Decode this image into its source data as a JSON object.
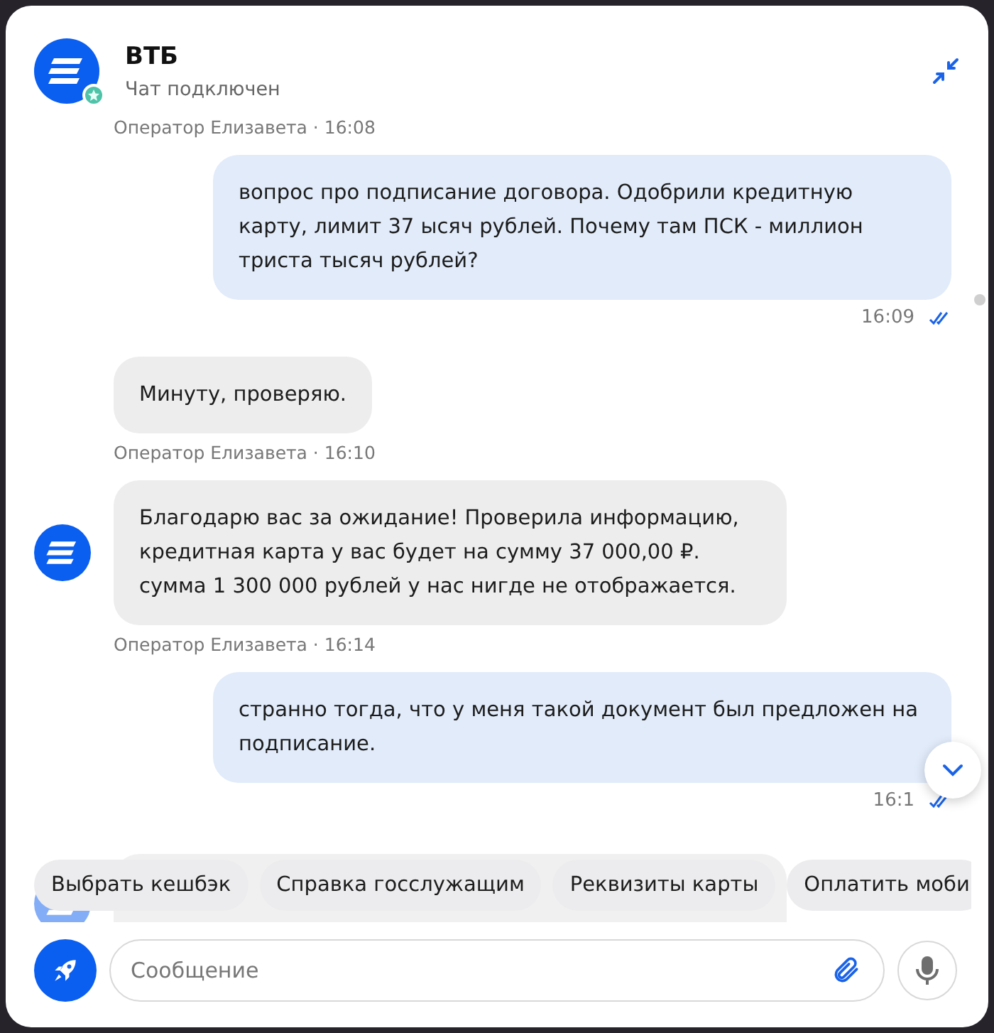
{
  "header": {
    "title": "ВТБ",
    "subtitle": "Чат подключен",
    "online": true
  },
  "messages": [
    {
      "kind": "caption",
      "text": "Оператор Елизавета · 16:08"
    },
    {
      "kind": "outgoing",
      "text": "вопрос про подписание договора. Одобрили кредитную карту, лимит 37 ысяч рублей. Почему там ПСК - миллион триста тысяч рублей?",
      "time": "16:09",
      "read": true
    },
    {
      "kind": "incoming",
      "text": "Минуту, проверяю.",
      "avatar": false
    },
    {
      "kind": "caption",
      "text": "Оператор Елизавета · 16:10"
    },
    {
      "kind": "incoming",
      "text": "Благодарю вас за ожидание! Проверила информацию, кредитная карта у вас будет на сумму 37 000,00 ₽. сумма 1 300 000 рублей  у нас нигде не отображается.",
      "avatar": true
    },
    {
      "kind": "caption",
      "text": "Оператор Елизавета · 16:14"
    },
    {
      "kind": "outgoing",
      "text": "странно тогда, что у меня такой документ был предложен на подписание.",
      "time": "16:1",
      "read": true
    }
  ],
  "quick_replies": [
    "Выбрать кешбэк",
    "Справка госслужащим",
    "Реквизиты карты",
    "Оплатить моби"
  ],
  "composer": {
    "placeholder": "Сообщение"
  }
}
